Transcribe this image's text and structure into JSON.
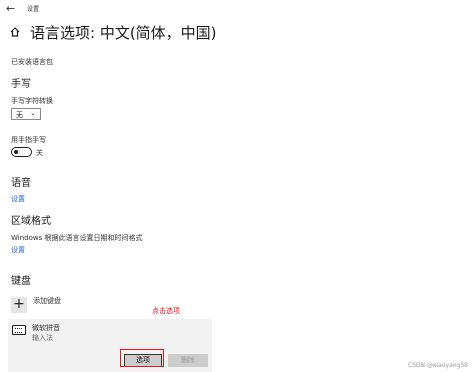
{
  "titlebar": {
    "back_glyph": "←",
    "title": "设置"
  },
  "header": {
    "home_icon": "home-icon",
    "title": "语言选项: 中文(简体，中国)"
  },
  "downloads": {
    "installed_text": "已安装语言包"
  },
  "handwriting": {
    "heading": "手写",
    "conversion_label": "手写字符转换",
    "conversion_value": "无",
    "finger_label": "用手指手写",
    "finger_toggle_state": "关"
  },
  "speech": {
    "heading": "语音",
    "settings_link": "设置"
  },
  "region": {
    "heading": "区域格式",
    "description": "Windows 根据此语言设置日期和时间格式",
    "settings_link": "设置"
  },
  "keyboard": {
    "heading": "键盘",
    "add_label": "添加键盘",
    "annotation": "点击选项",
    "items": [
      {
        "name": "微软拼音",
        "type": "输入法",
        "icon": "keyboard-icon"
      }
    ],
    "options_label": "选项",
    "delete_label": "删除"
  },
  "watermark": "CSDN @xiaoyang58",
  "colors": {
    "accent": "#2a69c7",
    "annotation": "#e4151d"
  }
}
